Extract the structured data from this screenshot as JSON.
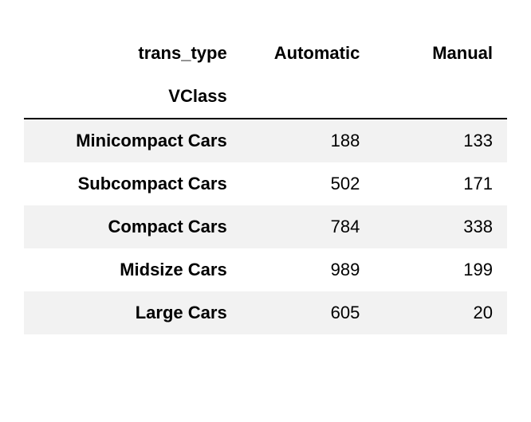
{
  "chart_data": {
    "type": "table",
    "column_label": "trans_type",
    "row_label": "VClass",
    "columns": [
      "Automatic",
      "Manual"
    ],
    "rows": [
      {
        "label": "Minicompact Cars",
        "values": [
          188,
          133
        ]
      },
      {
        "label": "Subcompact Cars",
        "values": [
          502,
          171
        ]
      },
      {
        "label": "Compact Cars",
        "values": [
          784,
          338
        ]
      },
      {
        "label": "Midsize Cars",
        "values": [
          989,
          199
        ]
      },
      {
        "label": "Large Cars",
        "values": [
          605,
          20
        ]
      }
    ]
  }
}
